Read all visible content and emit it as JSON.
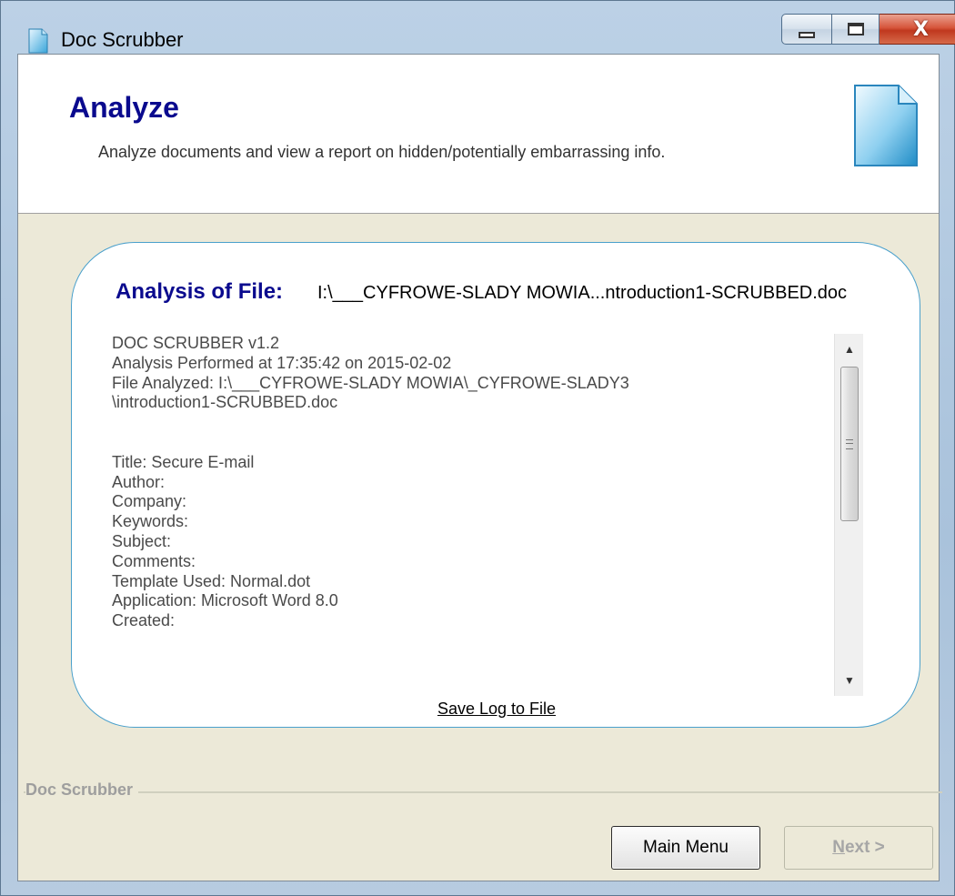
{
  "window": {
    "title": "Doc Scrubber",
    "close_glyph": "X"
  },
  "header": {
    "title": "Analyze",
    "subtitle": "Analyze documents and view a report on hidden/potentially embarrassing info."
  },
  "analysis": {
    "label": "Analysis of File:",
    "path": "I:\\___CYFROWE-SLADY MOWIA...ntroduction1-SCRUBBED.doc"
  },
  "log": {
    "text": "DOC SCRUBBER v1.2\nAnalysis Performed at 17:35:42 on 2015-02-02\nFile Analyzed: I:\\___CYFROWE-SLADY MOWIA\\_CYFROWE-SLADY3\n\\introduction1-SCRUBBED.doc\n\n\nTitle: Secure E-mail\nAuthor:\nCompany:\nKeywords:\nSubject:\nComments:\nTemplate Used: Normal.dot\nApplication: Microsoft Word 8.0\nCreated:"
  },
  "save_log_label": "Save Log to File",
  "group_label": "Doc Scrubber",
  "buttons": {
    "main_menu": "Main Menu",
    "next_mnemonic": "N",
    "next_rest": "ext >"
  },
  "icons": {
    "title": "document-icon",
    "header": "document-icon"
  }
}
